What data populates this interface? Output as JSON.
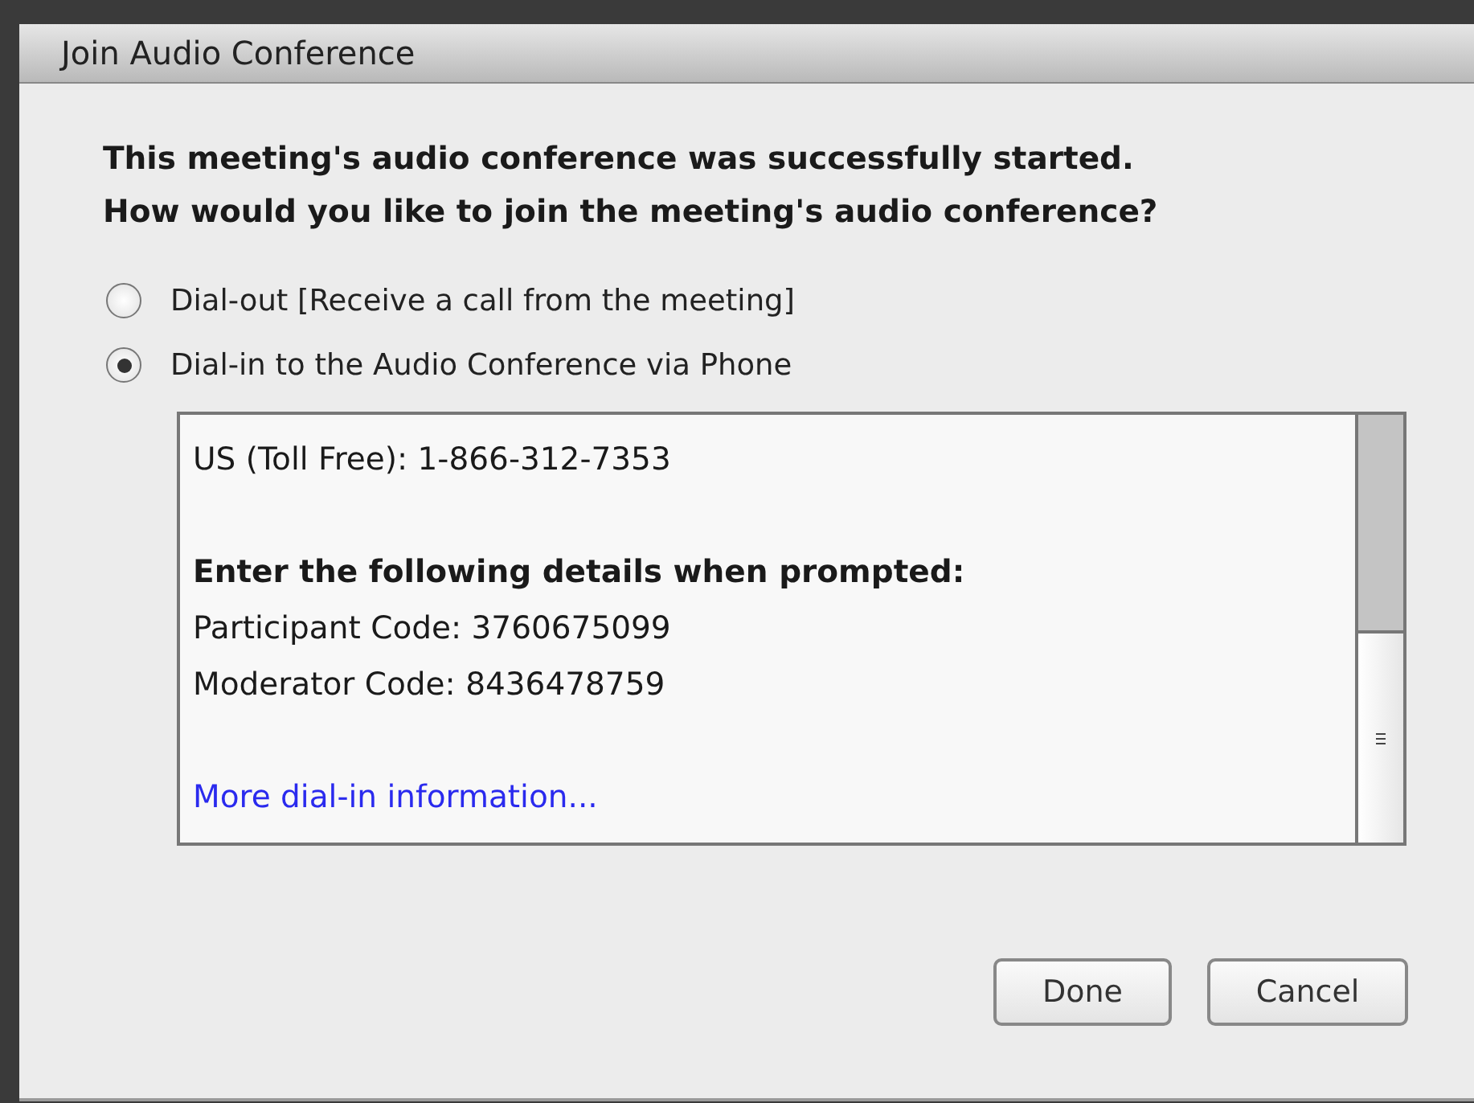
{
  "window": {
    "title": "Join Audio Conference"
  },
  "message": [
    "This meeting's audio conference was successfully started.",
    "How would you like to join the meeting's audio conference?"
  ],
  "options": [
    {
      "label": "Dial-out [Receive a call from the meeting]",
      "selected": false
    },
    {
      "label": "Dial-in to the Audio Conference via Phone",
      "selected": true
    }
  ],
  "details": [
    {
      "kind": "text",
      "text": "US (Toll Free): 1-866-312-7353"
    },
    {
      "kind": "gap"
    },
    {
      "kind": "heading",
      "text": "Enter the following details when prompted:"
    },
    {
      "kind": "text",
      "text": "Participant Code: 3760675099"
    },
    {
      "kind": "text",
      "text": "Moderator Code: 8436478759"
    },
    {
      "kind": "gap"
    },
    {
      "kind": "link",
      "text": "More dial-in information..."
    }
  ],
  "buttons": [
    "Done",
    "Cancel"
  ]
}
